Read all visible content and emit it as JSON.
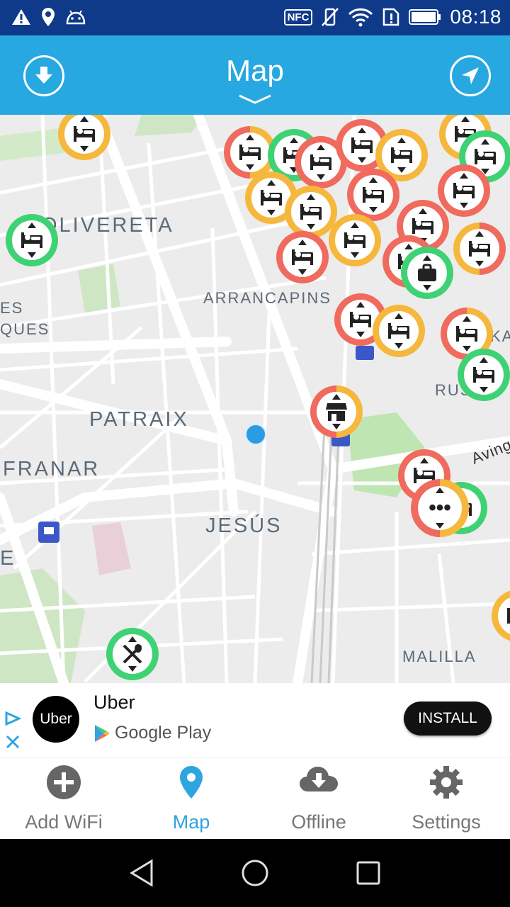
{
  "status_bar": {
    "time": "08:18",
    "nfc_label": "NFC"
  },
  "app_bar": {
    "title": "Map"
  },
  "map": {
    "labels": {
      "olivereta": "OLIVERETA",
      "arrancapins": "ARRANCAPINS",
      "patraix": "PATRAIX",
      "franar": "FRANAR",
      "jesus": "JESÚS",
      "malilla": "MALILLA",
      "es": "ES",
      "ques": "QUES",
      "rus": "RUS",
      "ka": "KA",
      "e": "E",
      "avingu": "Avingu"
    },
    "more_marker_label": "•••"
  },
  "ad": {
    "advertiser": "Uber",
    "logo_text": "Uber",
    "store": "Google Play",
    "install_label": "INSTALL"
  },
  "bottom_nav": {
    "items": [
      {
        "label": "Add WiFi",
        "icon": "add-circle-icon"
      },
      {
        "label": "Map",
        "icon": "map-pin-icon"
      },
      {
        "label": "Offline",
        "icon": "cloud-download-icon"
      },
      {
        "label": "Settings",
        "icon": "gear-icon"
      }
    ],
    "active": "Map"
  },
  "colors": {
    "status_bar": "#0f3a8a",
    "app_bar": "#27a8e0",
    "active_tab": "#2ea4e0",
    "marker_red": "#f06a5e",
    "marker_green": "#3fd275",
    "marker_orange": "#f6b73d"
  }
}
